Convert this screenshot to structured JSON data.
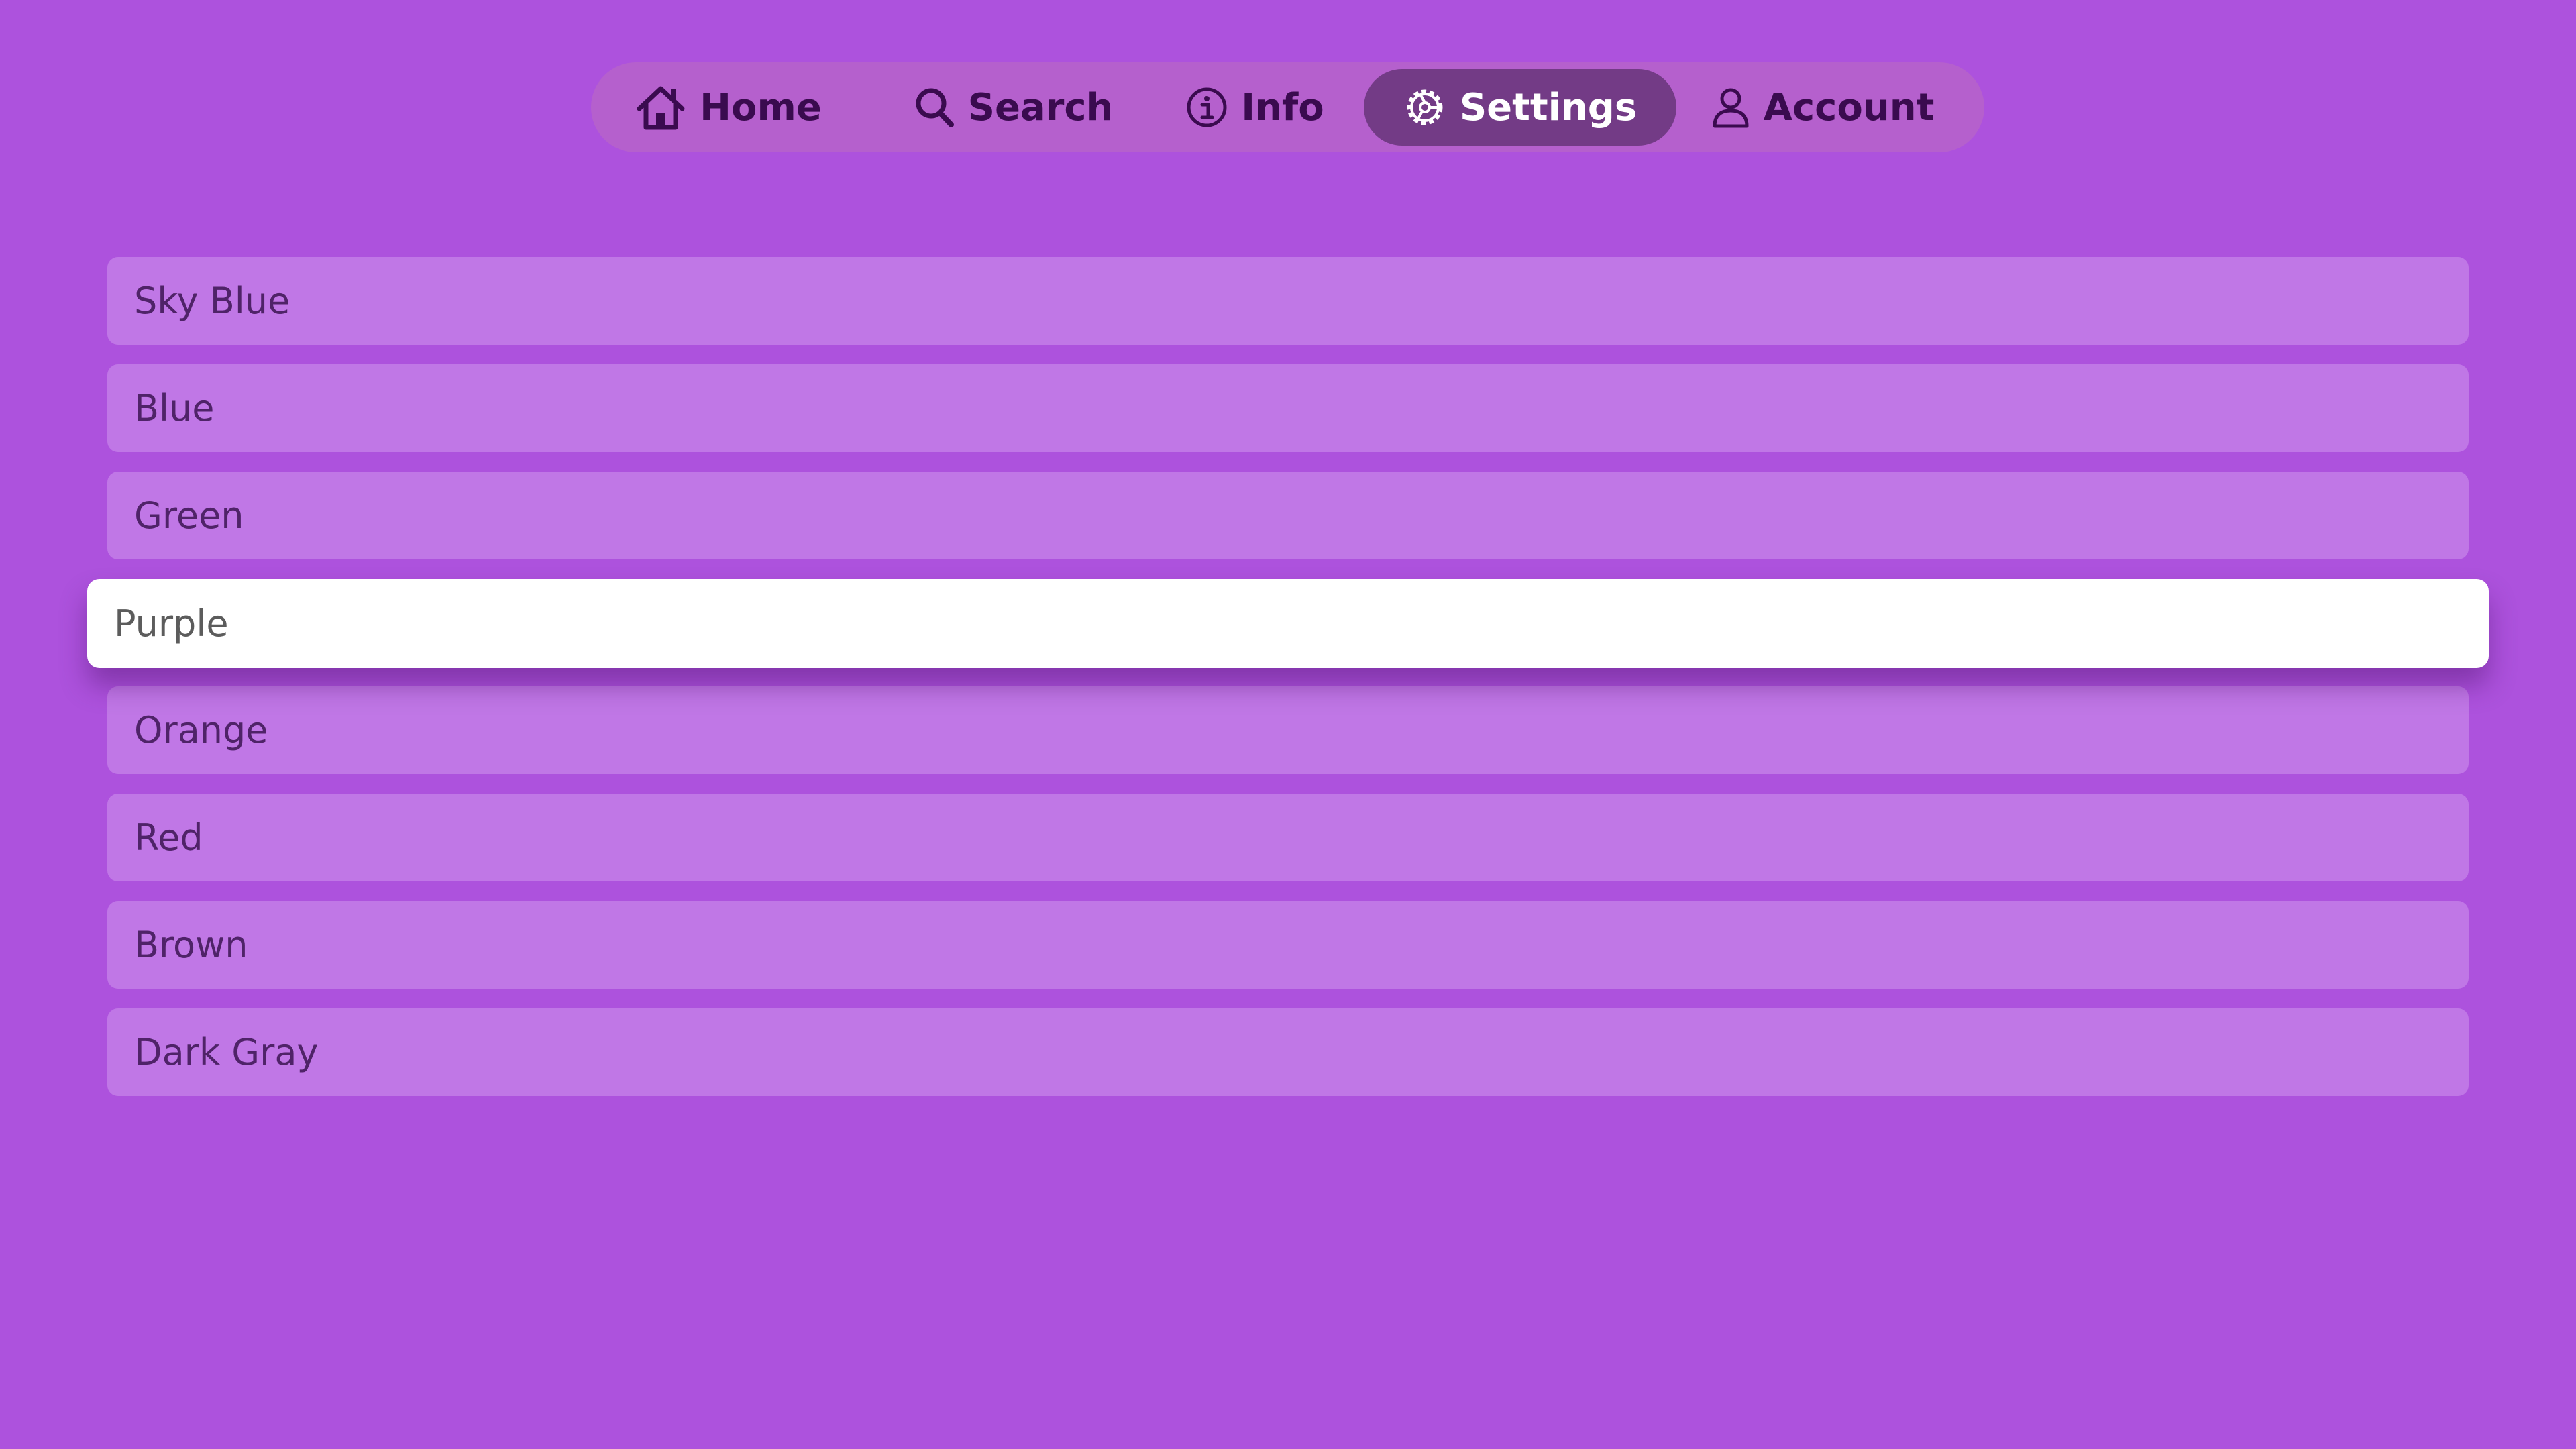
{
  "nav": {
    "tabs": [
      {
        "label": "Home",
        "icon": "house-icon"
      },
      {
        "label": "Search",
        "icon": "magnifier-icon"
      },
      {
        "label": "Info",
        "icon": "info-circle-icon"
      },
      {
        "label": "Settings",
        "icon": "gear-icon"
      },
      {
        "label": "Account",
        "icon": "person-icon"
      }
    ],
    "selected_tab": "Settings"
  },
  "list": {
    "items": [
      {
        "label": "Sky Blue"
      },
      {
        "label": "Blue"
      },
      {
        "label": "Green"
      },
      {
        "label": "Purple"
      },
      {
        "label": "Orange"
      },
      {
        "label": "Red"
      },
      {
        "label": "Brown"
      },
      {
        "label": "Dark Gray"
      }
    ],
    "focused_item": "Purple"
  },
  "colors": {
    "background": "#ad52dd",
    "tabbar_background": "#b560cd",
    "selected_tab": "#733b86",
    "list_item": "#c077e6",
    "focused_item": "#ffffff",
    "tab_text": "#3a0b4f"
  }
}
